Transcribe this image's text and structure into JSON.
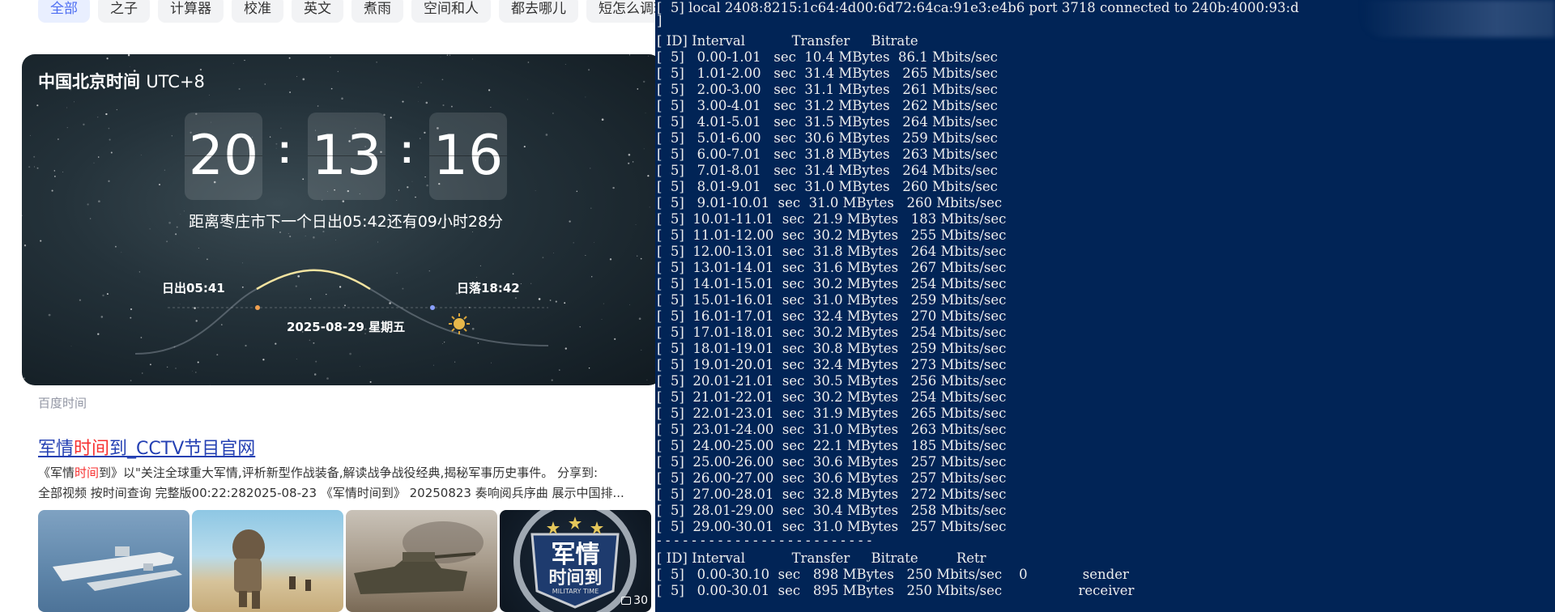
{
  "tabs": [
    "全部",
    "之子",
    "计算器",
    "校准",
    "英文",
    "煮雨",
    "空间和人",
    "都去哪儿",
    "短怎么调理"
  ],
  "time_card": {
    "title": "中国北京时间",
    "utc": "UTC+8",
    "hours": "20",
    "minutes": "13",
    "seconds": "16",
    "colon": ":",
    "sunrise_note": "距离枣庄市下一个日出05:42还有09小时28分",
    "sunrise": "日出05:41",
    "sunset": "日落18:42",
    "date": "2025-08-29   星期五"
  },
  "source": "百度时间",
  "result": {
    "title_a": "军情",
    "title_hl": "时间",
    "title_b": "到_CCTV节目官网",
    "desc1_a": "《军情",
    "desc1_hl": "时间",
    "desc1_b": "到》以\"关注全球重大军情,评析新型作战装备,解读战争战役经典,揭秘军事历史事件。 分享到:",
    "desc2": "全部视频 按时间查询 完整版00:22:282025-08-23 《军情时间到》 20250823 奏响阅兵序曲 展示中国排..."
  },
  "thumbnails": [
    {
      "name": "carrier-thumbnail"
    },
    {
      "name": "soldier-thumbnail"
    },
    {
      "name": "tank-thumbnail"
    },
    {
      "name": "program-logo-thumbnail",
      "logo_line1": "军情",
      "logo_line2": "时间到",
      "logo_sub": "MILITARY TIME",
      "badge": "30"
    }
  ],
  "terminal": {
    "connect_line": "[  5] local 2408:8215:1c64:4d00:6d72:64ca:91e3:e4b6 port 3718 connected to 240b:4000:93:d",
    "bracket_line": "]",
    "header": "[ ID] Interval           Transfer     Bitrate",
    "rows": [
      "[  5]   0.00-1.01   sec  10.4 MBytes  86.1 Mbits/sec",
      "[  5]   1.01-2.00   sec  31.4 MBytes   265 Mbits/sec",
      "[  5]   2.00-3.00   sec  31.1 MBytes   261 Mbits/sec",
      "[  5]   3.00-4.01   sec  31.2 MBytes   262 Mbits/sec",
      "[  5]   4.01-5.01   sec  31.5 MBytes   264 Mbits/sec",
      "[  5]   5.01-6.00   sec  30.6 MBytes   259 Mbits/sec",
      "[  5]   6.00-7.01   sec  31.8 MBytes   263 Mbits/sec",
      "[  5]   7.01-8.01   sec  31.4 MBytes   264 Mbits/sec",
      "[  5]   8.01-9.01   sec  31.0 MBytes   260 Mbits/sec",
      "[  5]   9.01-10.01  sec  31.0 MBytes   260 Mbits/sec",
      "[  5]  10.01-11.01  sec  21.9 MBytes   183 Mbits/sec",
      "[  5]  11.01-12.00  sec  30.2 MBytes   255 Mbits/sec",
      "[  5]  12.00-13.01  sec  31.8 MBytes   264 Mbits/sec",
      "[  5]  13.01-14.01  sec  31.6 MBytes   267 Mbits/sec",
      "[  5]  14.01-15.01  sec  30.2 MBytes   254 Mbits/sec",
      "[  5]  15.01-16.01  sec  31.0 MBytes   259 Mbits/sec",
      "[  5]  16.01-17.01  sec  32.4 MBytes   270 Mbits/sec",
      "[  5]  17.01-18.01  sec  30.2 MBytes   254 Mbits/sec",
      "[  5]  18.01-19.01  sec  30.8 MBytes   259 Mbits/sec",
      "[  5]  19.01-20.01  sec  32.4 MBytes   273 Mbits/sec",
      "[  5]  20.01-21.01  sec  30.5 MBytes   256 Mbits/sec",
      "[  5]  21.01-22.01  sec  30.2 MBytes   254 Mbits/sec",
      "[  5]  22.01-23.01  sec  31.9 MBytes   265 Mbits/sec",
      "[  5]  23.01-24.00  sec  31.0 MBytes   263 Mbits/sec",
      "[  5]  24.00-25.00  sec  22.1 MBytes   185 Mbits/sec",
      "[  5]  25.00-26.00  sec  30.6 MBytes   257 Mbits/sec",
      "[  5]  26.00-27.00  sec  30.6 MBytes   257 Mbits/sec",
      "[  5]  27.00-28.01  sec  32.8 MBytes   272 Mbits/sec",
      "[  5]  28.01-29.00  sec  30.4 MBytes   258 Mbits/sec",
      "[  5]  29.00-30.01  sec  31.0 MBytes   257 Mbits/sec"
    ],
    "separator": "- - - - - - - - - - - - - - - - - - - - - - - - -",
    "summary_header": "[ ID] Interval           Transfer     Bitrate         Retr",
    "summary_rows": [
      "[  5]   0.00-30.10  sec   898 MBytes   250 Mbits/sec    0             sender",
      "[  5]   0.00-30.01  sec   895 MBytes   250 Mbits/sec                  receiver"
    ]
  },
  "colors": {
    "terminal_bg": "#012456",
    "tab_active": "#4e6ef2",
    "link": "#2440b3",
    "highlight": "#f73131"
  }
}
